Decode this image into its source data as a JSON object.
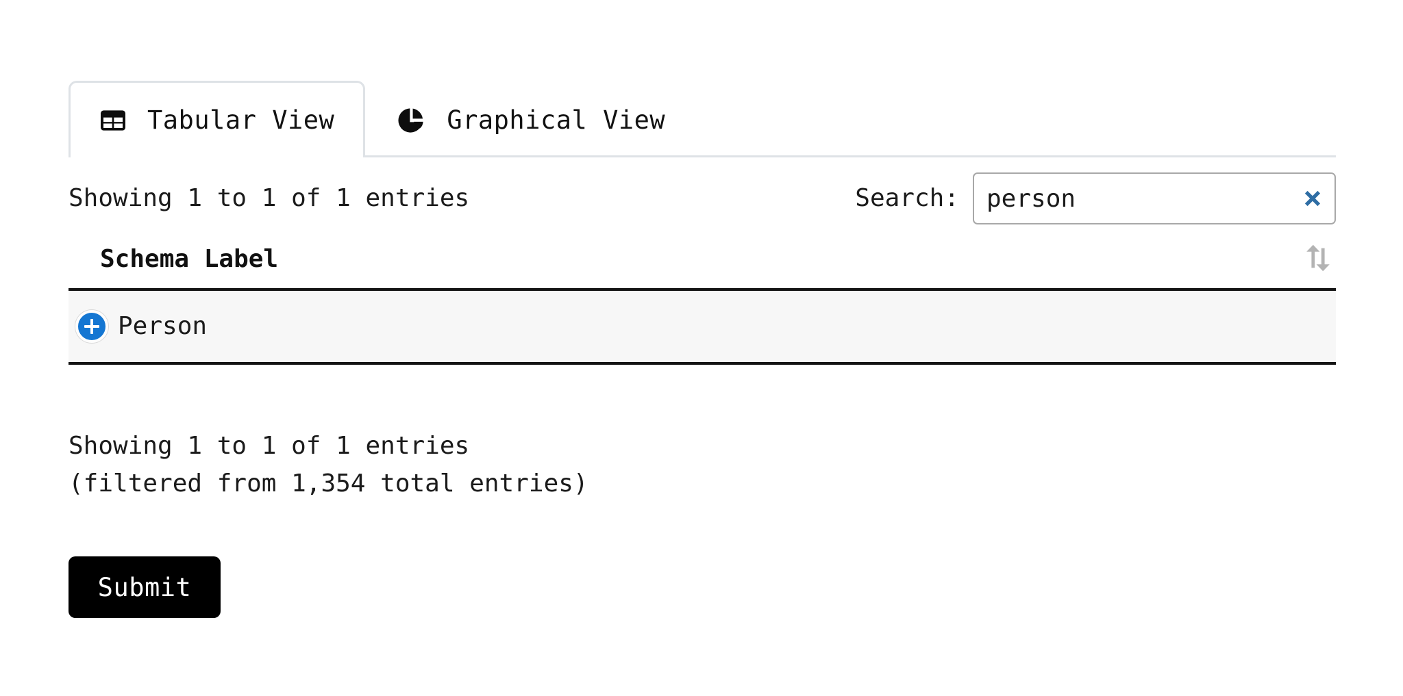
{
  "tabs": [
    {
      "id": "tabular",
      "label": "Tabular View",
      "icon": "table-grid-icon",
      "active": true
    },
    {
      "id": "graphical",
      "label": "Graphical View",
      "icon": "pie-chart-icon",
      "active": false
    }
  ],
  "table_info": {
    "showing_top": "Showing 1 to 1 of 1 entries",
    "showing_bottom": "Showing 1 to 1 of 1 entries",
    "filtered_note": "(filtered from 1,354 total entries)"
  },
  "search": {
    "label": "Search:",
    "value": "person",
    "placeholder": "",
    "clear_icon": "close-x-icon",
    "clear_color": "#2e6da4"
  },
  "table": {
    "columns": [
      {
        "key": "schema_label",
        "label": "Schema Label",
        "sortable": true,
        "sort_icon": "sort-updown-icon"
      }
    ],
    "rows": [
      {
        "expand_icon": "plus-circle-icon",
        "schema_label": "Person"
      }
    ]
  },
  "actions": {
    "submit_label": "Submit"
  },
  "colors": {
    "accent_blue": "#1476d2",
    "clear_blue": "#2e6da4",
    "row_background": "#f7f7f7",
    "border_dark": "#141414",
    "tab_border": "#dee2e6",
    "submit_background": "#000000"
  }
}
